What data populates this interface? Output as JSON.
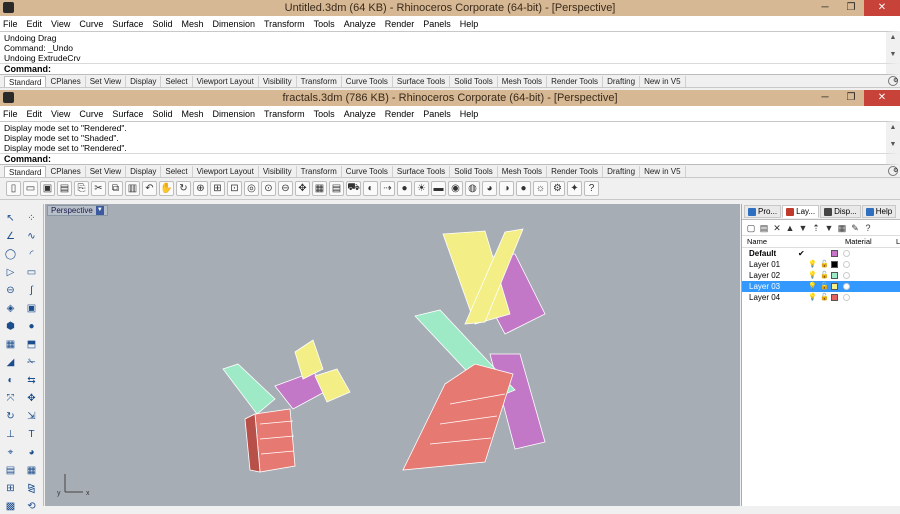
{
  "win1": {
    "title": "Untitled.3dm (64 KB) - Rhinoceros Corporate (64-bit) - [Perspective]",
    "history": [
      "Undoing Drag",
      "Command: _Undo",
      "Undoing ExtrudeCrv"
    ],
    "command_label": "Command:"
  },
  "win2": {
    "title": "fractals.3dm (786 KB) - Rhinoceros Corporate (64-bit) - [Perspective]",
    "history": [
      "Display mode set to \"Rendered\".",
      "Display mode set to \"Shaded\".",
      "Display mode set to \"Rendered\"."
    ],
    "command_label": "Command:"
  },
  "menu": [
    "File",
    "Edit",
    "View",
    "Curve",
    "Surface",
    "Solid",
    "Mesh",
    "Dimension",
    "Transform",
    "Tools",
    "Analyze",
    "Render",
    "Panels",
    "Help"
  ],
  "toolbar_tabs": [
    "Standard",
    "CPlanes",
    "Set View",
    "Display",
    "Select",
    "Viewport Layout",
    "Visibility",
    "Transform",
    "Curve Tools",
    "Surface Tools",
    "Solid Tools",
    "Mesh Tools",
    "Render Tools",
    "Drafting",
    "New in V5"
  ],
  "viewport": {
    "label": "Perspective",
    "axis_x": "x",
    "axis_y": "y"
  },
  "panel": {
    "tabs": [
      {
        "label": "Pro...",
        "color": "#2f6fc0"
      },
      {
        "label": "Lay...",
        "color": "#c0392b"
      },
      {
        "label": "Disp...",
        "color": "#444444"
      },
      {
        "label": "Help",
        "color": "#2f6fc0"
      }
    ],
    "active_tab": 1,
    "columns": {
      "name": "Name",
      "material": "Material",
      "extra": "L"
    },
    "layers": [
      {
        "name": "Default",
        "current": true,
        "color": "#c774c9",
        "bold": true,
        "selected": false
      },
      {
        "name": "Layer 01",
        "current": false,
        "color": "#000000",
        "bold": false,
        "selected": false
      },
      {
        "name": "Layer 02",
        "current": false,
        "color": "#9eebc7",
        "bold": false,
        "selected": false
      },
      {
        "name": "Layer 03",
        "current": false,
        "color": "#f4f08a",
        "bold": false,
        "selected": true
      },
      {
        "name": "Layer 04",
        "current": false,
        "color": "#e6605f",
        "bold": false,
        "selected": false
      }
    ],
    "current_mark": "✔"
  },
  "icons": {
    "win_min": "─",
    "win_max": "❐",
    "win_close": "✕",
    "scroll_up": "▲",
    "scroll_down": "▼"
  }
}
